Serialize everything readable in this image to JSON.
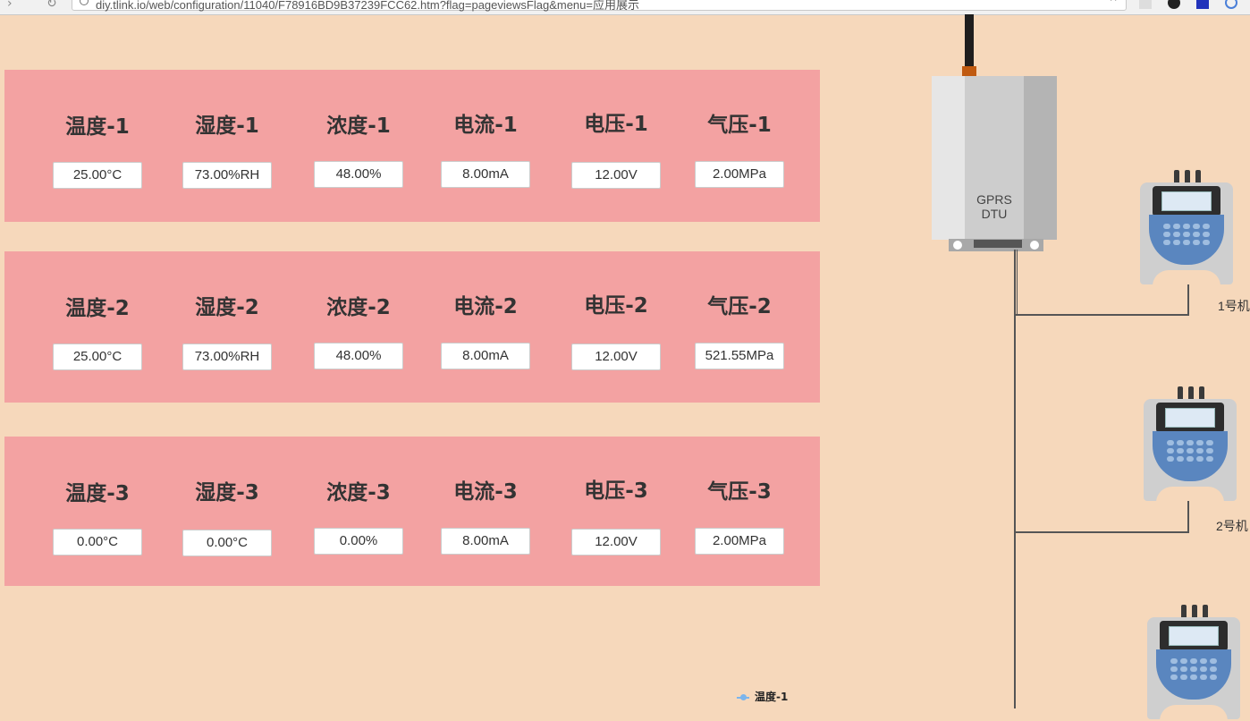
{
  "browser": {
    "url": "diy.tlink.io/web/configuration/11040/F78916BD9B37239FCC62.htm?flag=pageviewsFlag&menu=应用展示"
  },
  "panels": [
    {
      "sensors": [
        {
          "label": "温度-1",
          "value": "25.00°C"
        },
        {
          "label": "湿度-1",
          "value": "73.00%RH"
        },
        {
          "label": "浓度-1",
          "value": "48.00%"
        },
        {
          "label": "电流-1",
          "value": "8.00mA"
        },
        {
          "label": "电压-1",
          "value": "12.00V"
        },
        {
          "label": "气压-1",
          "value": "2.00MPa"
        }
      ]
    },
    {
      "sensors": [
        {
          "label": "温度-2",
          "value": "25.00°C"
        },
        {
          "label": "湿度-2",
          "value": "73.00%RH"
        },
        {
          "label": "浓度-2",
          "value": "48.00%"
        },
        {
          "label": "电流-2",
          "value": "8.00mA"
        },
        {
          "label": "电压-2",
          "value": "12.00V"
        },
        {
          "label": "气压-2",
          "value": "521.55MPa"
        }
      ]
    },
    {
      "sensors": [
        {
          "label": "温度-3",
          "value": "0.00°C"
        },
        {
          "label": "湿度-3",
          "value": "0.00°C"
        },
        {
          "label": "浓度-3",
          "value": "0.00%"
        },
        {
          "label": "电流-3",
          "value": "8.00mA"
        },
        {
          "label": "电压-3",
          "value": "12.00V"
        },
        {
          "label": "气压-3",
          "value": "2.00MPa"
        }
      ]
    }
  ],
  "dtu": {
    "line1": "GPRS",
    "line2": "DTU"
  },
  "machines": [
    {
      "label": "1号机"
    },
    {
      "label": "2号机"
    },
    {
      "label": ""
    }
  ],
  "chart_legend": {
    "series1": "温度-1"
  },
  "colors": {
    "background": "#f6d8bb",
    "panel": "#f3a2a2",
    "keypad": "#5a86bf"
  }
}
